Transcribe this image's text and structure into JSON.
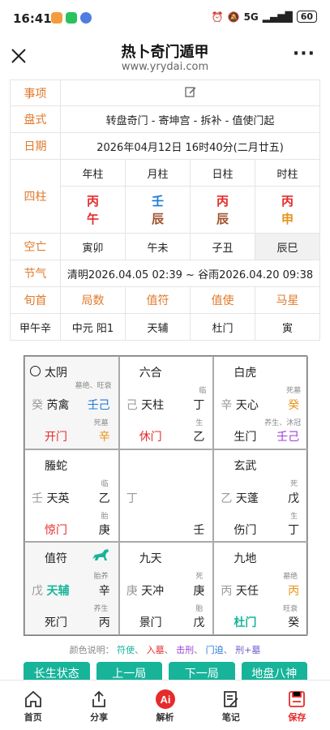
{
  "status": {
    "time": "16:41",
    "signal": "5G",
    "battery": "60"
  },
  "header": {
    "title": "热卜奇门遁甲",
    "url": "www.yrydai.com"
  },
  "info": {
    "matter_label": "事项",
    "layout_label": "盘式",
    "layout_value": "转盘奇门 - 寄坤宫 - 拆补 - 值使门起",
    "date_label": "日期",
    "date_value": "2026年04月12日 16时40分(二月廿五)",
    "pillars_label": "四柱",
    "pillar_headers": [
      "年柱",
      "月柱",
      "日柱",
      "时柱"
    ],
    "pillars": [
      {
        "stem": "丙",
        "branch": "午"
      },
      {
        "stem": "壬",
        "branch": "辰"
      },
      {
        "stem": "丙",
        "branch": "辰"
      },
      {
        "stem": "丙",
        "branch": "申"
      }
    ],
    "kongwang_label": "空亡",
    "kongwang": [
      "寅卯",
      "午未",
      "子丑",
      "辰巳"
    ],
    "jieqi_label": "节气",
    "jieqi_value": "清明2026.04.05 02:39 ~ 谷雨2026.04.20 09:38",
    "row_headers": [
      "旬首",
      "局数",
      "值符",
      "值使",
      "马星"
    ],
    "row_values": [
      "甲午辛",
      "中元 阳1",
      "天辅",
      "杜门",
      "寅"
    ]
  },
  "palaces": [
    {
      "god": "太阴",
      "tag1": "墓绝、旺衰",
      "stem_l": "癸",
      "star": "芮禽",
      "stem_r": "壬己",
      "tag2": "死墓",
      "door": "开门",
      "cr": "辛"
    },
    {
      "god": "六合",
      "tag1": "临",
      "stem_l": "己",
      "star": "天柱",
      "stem_r": "丁",
      "tag2": "生",
      "door": "休门",
      "cr": "乙"
    },
    {
      "god": "白虎",
      "tag1": "死墓",
      "stem_l": "辛",
      "star": "天心",
      "stem_r": "癸",
      "tag2": "养生、沐冠",
      "door": "生门",
      "cr": "壬己"
    },
    {
      "god": "螣蛇",
      "tag1": "临",
      "stem_l": "壬",
      "star": "天英",
      "stem_r": "乙",
      "tag2": "胎",
      "door": "惊门",
      "cr": "庚"
    },
    {
      "god": "",
      "tag1": "",
      "stem_l": "丁",
      "star": "",
      "stem_r": "",
      "tag2": "",
      "door": "",
      "cr": "壬"
    },
    {
      "god": "玄武",
      "tag1": "死",
      "stem_l": "乙",
      "star": "天蓬",
      "stem_r": "戊",
      "tag2": "生",
      "door": "伤门",
      "cr": "丁"
    },
    {
      "god": "值符",
      "tag1": "胎养",
      "stem_l": "戊",
      "star": "天辅",
      "stem_r": "辛",
      "tag2": "养生",
      "door": "死门",
      "cr": "丙"
    },
    {
      "god": "九天",
      "tag1": "死",
      "stem_l": "庚",
      "star": "天冲",
      "stem_r": "庚",
      "tag2": "胎",
      "door": "景门",
      "cr": "戊"
    },
    {
      "god": "九地",
      "tag1": "墓绝",
      "stem_l": "丙",
      "star": "天任",
      "stem_r": "丙",
      "tag2": "旺衰",
      "door": "杜门",
      "cr": "癸"
    }
  ],
  "legend": {
    "prefix": "颜色说明：",
    "items": [
      "符使",
      "入墓",
      "击刑",
      "门迫",
      "刑+墓"
    ]
  },
  "buttons": [
    "长生状态",
    "上一局",
    "下一局",
    "地盘八神"
  ],
  "tabs": [
    "首页",
    "分享",
    "解析",
    "笔记",
    "保存"
  ],
  "colors": {
    "accent": "#17b49a",
    "red": "#e52b2b",
    "label": "#e07a2c"
  }
}
